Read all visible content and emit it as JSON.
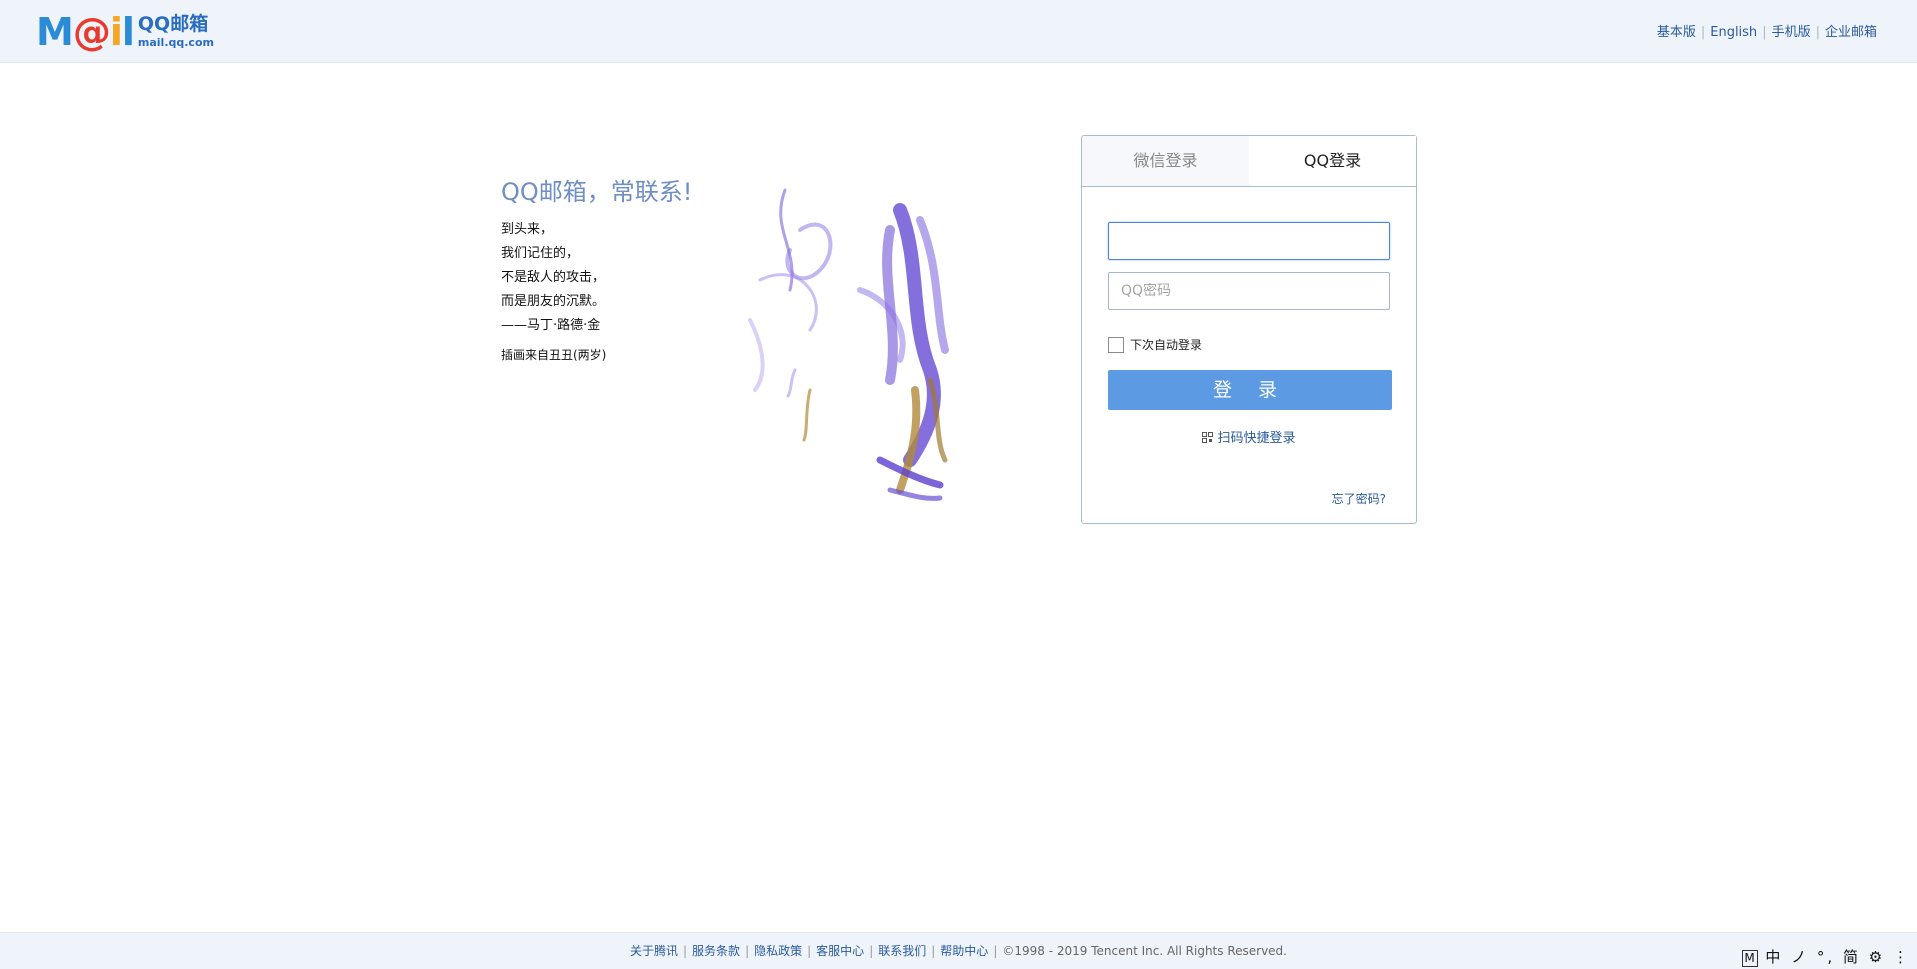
{
  "header": {
    "logo_word": "Mail",
    "logo_cn": "QQ邮箱",
    "logo_url": "mail.qq.com",
    "links": [
      "基本版",
      "English",
      "手机版",
      "企业邮箱"
    ]
  },
  "promo": {
    "slogan": "QQ邮箱，常联系!",
    "poem": [
      "到头来，",
      "我们记住的，",
      "不是敌人的攻击，",
      "而是朋友的沉默。",
      "——马丁·路德·金"
    ],
    "credit": "插画来自丑丑(两岁)"
  },
  "login": {
    "tabs": [
      "微信登录",
      "QQ登录"
    ],
    "active_tab": "QQ登录",
    "account_value": "",
    "password_placeholder": "QQ密码",
    "remember_label": "下次自动登录",
    "remember_checked": false,
    "login_button": "登 录",
    "qr_link": "扫码快捷登录",
    "forgot_link": "忘了密码?",
    "button_color": "#5c9be3"
  },
  "footer": {
    "links": [
      "关于腾讯",
      "服务条款",
      "隐私政策",
      "客服中心",
      "联系我们",
      "帮助中心"
    ],
    "copyright": "©1998 - 2019 Tencent Inc. All Rights Reserved."
  },
  "ime_bar": {
    "items": [
      "M",
      "中",
      "ノ",
      "°,",
      "简",
      "⚙",
      "⋮"
    ]
  }
}
